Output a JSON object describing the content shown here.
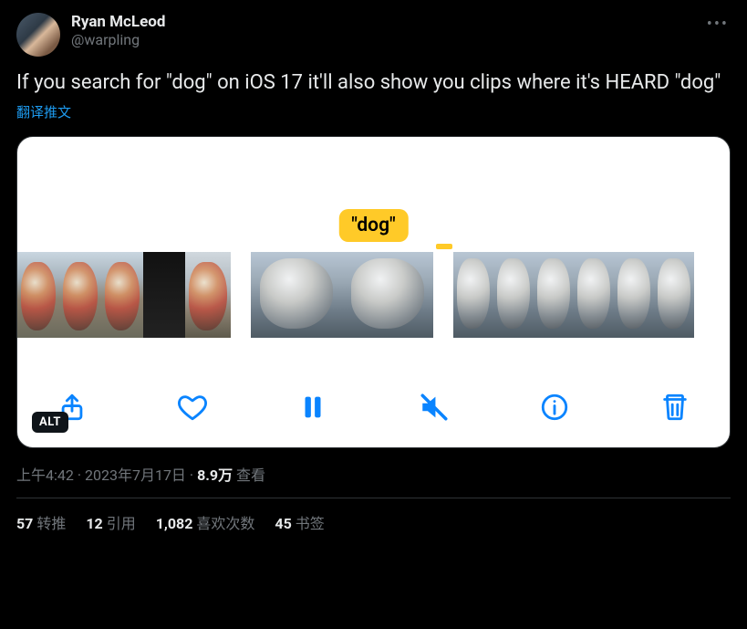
{
  "author": {
    "display_name": "Ryan McLeod",
    "handle": "@warpling"
  },
  "tweet_text": "If you search for \"dog\" on iOS 17 it'll also show you clips where it's HEARD \"dog\"",
  "translate_label": "翻译推文",
  "media": {
    "tooltip_text": "\"dog\"",
    "alt_badge": "ALT",
    "toolbar_icons": {
      "share": "share-icon",
      "heart": "heart-icon",
      "pause": "pause-icon",
      "mute": "mute-icon",
      "info": "info-icon",
      "trash": "trash-icon"
    }
  },
  "meta": {
    "time": "上午4:42",
    "dot1": " · ",
    "date": "2023年7月17日",
    "dot2": " · ",
    "views_number": "8.9万",
    "views_label": " 查看"
  },
  "stats": {
    "retweets_count": "57",
    "retweets_label": "转推",
    "quotes_count": "12",
    "quotes_label": "引用",
    "likes_count": "1,082",
    "likes_label": "喜欢次数",
    "bookmarks_count": "45",
    "bookmarks_label": "书签"
  }
}
